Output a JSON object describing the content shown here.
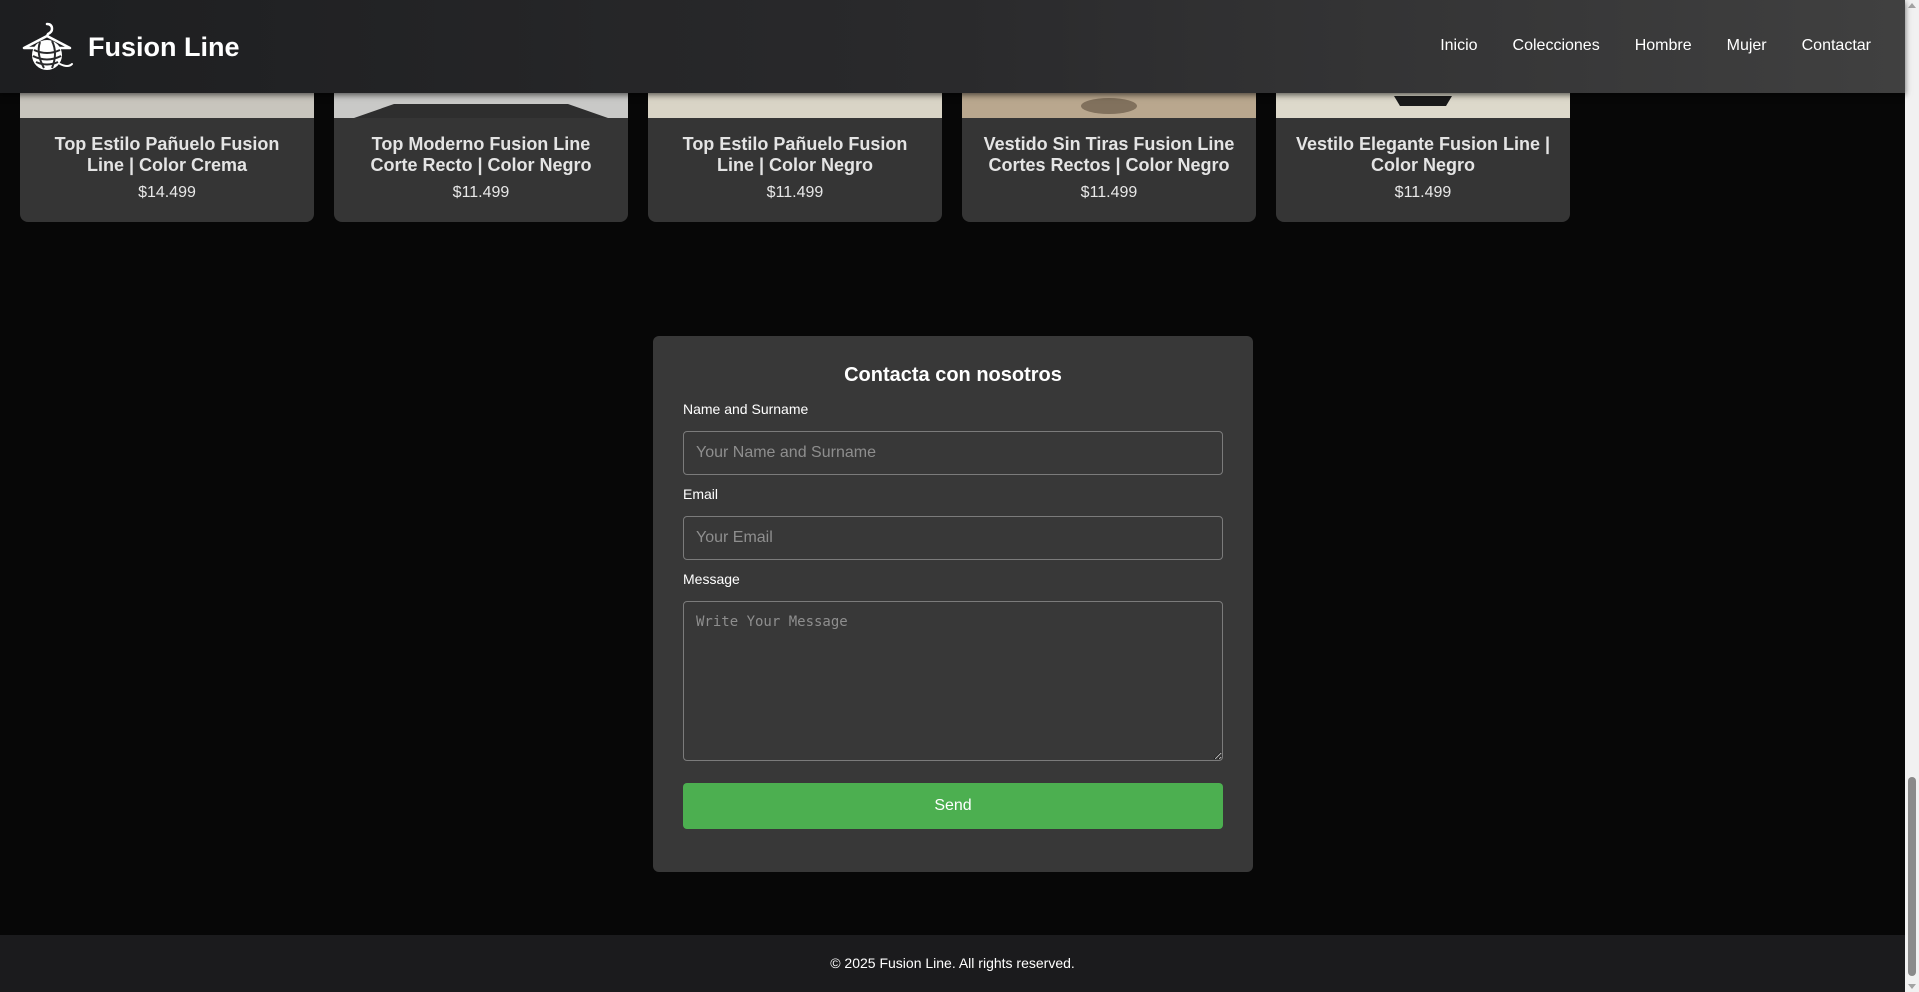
{
  "brand": {
    "name": "Fusion Line",
    "logo_icon": "yarn-hanger-icon"
  },
  "nav": {
    "items": [
      {
        "label": "Inicio"
      },
      {
        "label": "Colecciones"
      },
      {
        "label": "Hombre"
      },
      {
        "label": "Mujer"
      },
      {
        "label": "Contactar"
      }
    ]
  },
  "products": [
    {
      "title": "Top Estilo Pañuelo Fusion Line | Color Crema",
      "price": "$14.499",
      "image_color": "#c8c5bd"
    },
    {
      "title": "Top Moderno Fusion Line Corte Recto | Color Negro",
      "price": "$11.499",
      "image_color": "#c9c9c7"
    },
    {
      "title": "Top Estilo Pañuelo Fusion Line | Color Negro",
      "price": "$11.499",
      "image_color": "#d9d4c6"
    },
    {
      "title": "Vestido Sin Tiras Fusion Line Cortes Rectos | Color Negro",
      "price": "$11.499",
      "image_color": "#b9a78e"
    },
    {
      "title": "Vestilo Elegante Fusion Line | Color Negro",
      "price": "$11.499",
      "image_color": "#ddd9cb"
    }
  ],
  "contact": {
    "title": "Contacta con nosotros",
    "name_label": "Name and Surname",
    "name_placeholder": "Your Name and Surname",
    "name_value": "",
    "email_label": "Email",
    "email_placeholder": "Your Email",
    "email_value": "",
    "message_label": "Message",
    "message_placeholder": "Write Your Message",
    "message_value": "",
    "send_label": "Send",
    "send_color": "#4caf50"
  },
  "footer": {
    "text": "© 2025 Fusion Line. All rights reserved."
  }
}
